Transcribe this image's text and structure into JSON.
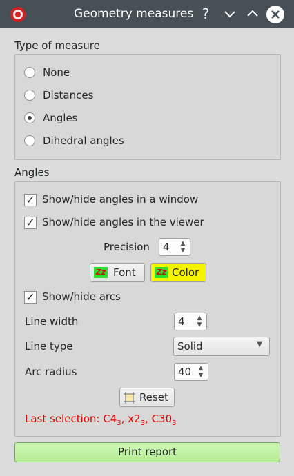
{
  "window": {
    "title": "Geometry measures"
  },
  "titlebar_buttons": [
    "help-icon",
    "minimize-icon",
    "maximize-icon",
    "close-icon"
  ],
  "measure_group": {
    "title": "Type of measure",
    "options": [
      "None",
      "Distances",
      "Angles",
      "Dihedral angles"
    ],
    "selected": "Angles"
  },
  "angles_group": {
    "title": "Angles",
    "show_window": {
      "label": "Show/hide angles in a window",
      "checked": true
    },
    "show_viewer": {
      "label": "Show/hide angles in the viewer",
      "checked": true
    },
    "precision": {
      "label": "Precision",
      "value": "4"
    },
    "font_button": "Font",
    "color_button": "Color",
    "show_arcs": {
      "label": "Show/hide arcs",
      "checked": true
    },
    "line_width": {
      "label": "Line width",
      "value": "4"
    },
    "line_type": {
      "label": "Line type",
      "value": "Solid"
    },
    "arc_radius": {
      "label": "Arc radius",
      "value": "40"
    },
    "reset_button": "Reset",
    "last_selection": {
      "prefix": "Last selection: ",
      "items": [
        {
          "base": "C4",
          "sub": "3",
          "sep": ", "
        },
        {
          "base": "x2",
          "sub": "3",
          "sep": ", "
        },
        {
          "base": "C30",
          "sub": "3",
          "sep": ""
        }
      ]
    }
  },
  "print_button": "Print report",
  "colors": {
    "titlebar": "#475057",
    "accent_green": "#b6ec95",
    "color_button": "#f4f400",
    "status_red": "#e00000"
  }
}
